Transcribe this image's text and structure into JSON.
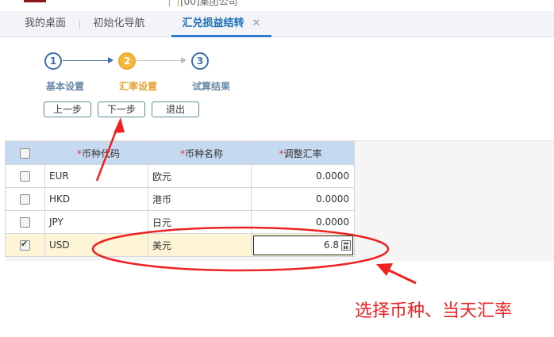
{
  "top_fragment": "[00]集团公司",
  "tabs": [
    {
      "label": "我的桌面"
    },
    {
      "label": "初始化导航"
    },
    {
      "label": "汇兑损益结转",
      "close": "✕"
    }
  ],
  "wizard": {
    "steps": [
      {
        "num": "1",
        "label": "基本设置"
      },
      {
        "num": "2",
        "label": "汇率设置"
      },
      {
        "num": "3",
        "label": "试算结果"
      }
    ],
    "current_step": 2
  },
  "buttons": {
    "prev": "上一步",
    "next": "下一步",
    "exit": "退出"
  },
  "table": {
    "required_mark": "*",
    "columns": [
      "币种代码",
      "币种名称",
      "调整汇率"
    ],
    "rows": [
      {
        "code": "EUR",
        "name": "欧元",
        "rate": "0.0000",
        "checked": false
      },
      {
        "code": "HKD",
        "name": "港币",
        "rate": "0.0000",
        "checked": false
      },
      {
        "code": "JPY",
        "name": "日元",
        "rate": "0.0000",
        "checked": false
      },
      {
        "code": "USD",
        "name": "美元",
        "rate": "6.8",
        "checked": true
      }
    ]
  },
  "annotation": {
    "text": "选择币种、当天汇率",
    "color": "#ee2222"
  },
  "colors": {
    "accent": "#2a7cd0",
    "current_step": "#f5b740",
    "header_bg": "#c5daf1",
    "selected_row": "#fdf5d6"
  }
}
